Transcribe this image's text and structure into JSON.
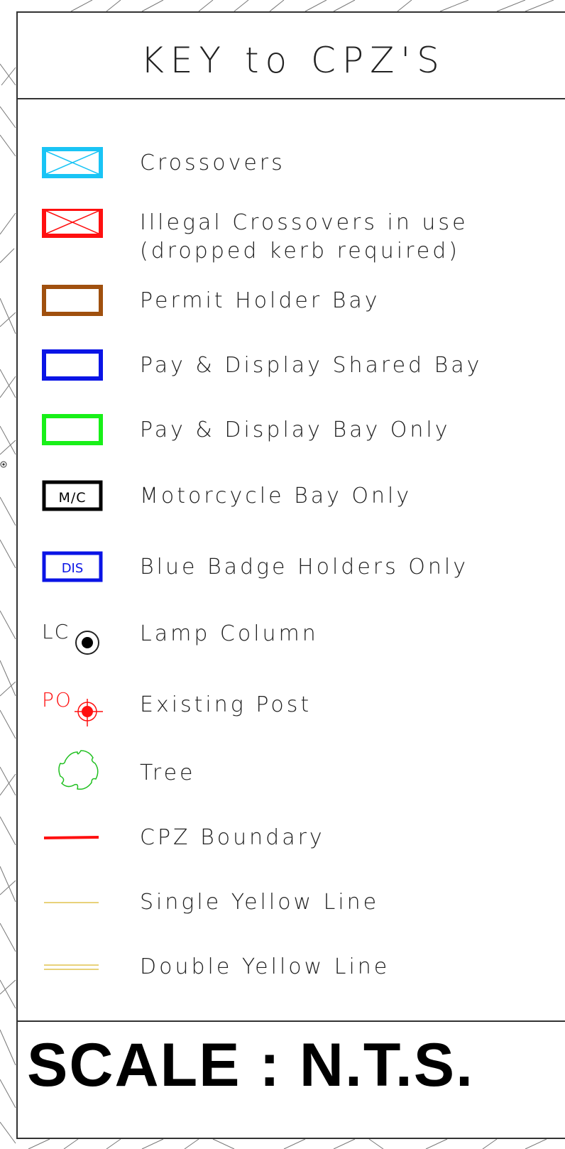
{
  "title": "KEY to CPZ'S",
  "legend": [
    {
      "id": "crossovers",
      "label": "Crossovers",
      "color": "#19c4f5"
    },
    {
      "id": "illegal",
      "label_line1": "Illegal Crossovers in use",
      "label_line2": "(dropped kerb required)",
      "color": "#ff1010"
    },
    {
      "id": "permit",
      "label": "Permit Holder Bay",
      "color": "#a0500e"
    },
    {
      "id": "shared",
      "label": "Pay & Display Shared Bay",
      "color": "#0a14e6"
    },
    {
      "id": "paydisplay",
      "label": "Pay & Display Bay Only",
      "color": "#18f018"
    },
    {
      "id": "motorcycle",
      "label": "Motorcycle Bay Only",
      "symbol_text": "M/C",
      "color": "#000000"
    },
    {
      "id": "bluebadge",
      "label": "Blue Badge Holders Only",
      "symbol_text": "DIS",
      "color": "#0a14e6"
    },
    {
      "id": "lamp",
      "label": "Lamp Column",
      "symbol_text": "LC",
      "color": "#222222"
    },
    {
      "id": "post",
      "label": "Existing Post",
      "symbol_text": "PO",
      "color": "#ff1010"
    },
    {
      "id": "tree",
      "label": "Tree",
      "color": "#20c020"
    },
    {
      "id": "boundary",
      "label": "CPZ Boundary",
      "color": "#ff1010"
    },
    {
      "id": "syl",
      "label": "Single Yellow Line",
      "color": "#e8d27a"
    },
    {
      "id": "dyl",
      "label": "Double Yellow Line",
      "color": "#e8d27a"
    }
  ],
  "scale": "SCALE : N.T.S."
}
